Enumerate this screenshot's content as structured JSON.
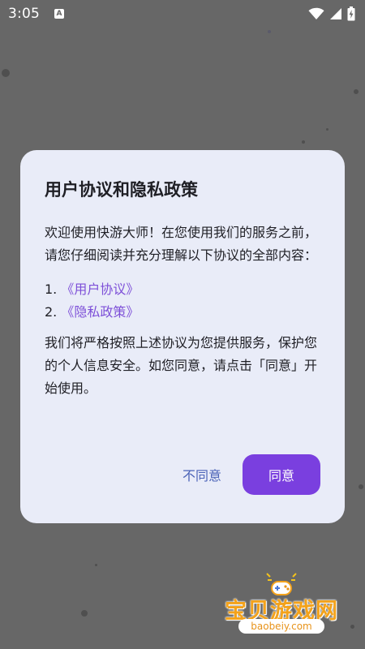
{
  "status_bar": {
    "time": "3:05",
    "notification_glyph": "A",
    "icons": [
      "wifi-icon",
      "signal-icon",
      "battery-charging-icon"
    ]
  },
  "dialog": {
    "title": "用户协议和隐私政策",
    "intro": "欢迎使用快游大师！在您使用我们的服务之前，请您仔细阅读并充分理解以下协议的全部内容：",
    "agreements": [
      {
        "num": "1.",
        "label": "《用户协议》"
      },
      {
        "num": "2.",
        "label": "《隐私政策》"
      }
    ],
    "body": "我们将严格按照上述协议为您提供服务，保护您的个人信息安全。如您同意，请点击「同意」开始使用。",
    "disagree_label": "不同意",
    "agree_label": "同意"
  },
  "watermark": {
    "text": "宝贝游戏网",
    "url": "baobeiy.com"
  },
  "colors": {
    "overlay": "#676767",
    "dialog_bg": "#e9ecf8",
    "link": "#7d4fd8",
    "primary": "#7a3fdf",
    "secondary_text_button": "#4a62b7"
  }
}
